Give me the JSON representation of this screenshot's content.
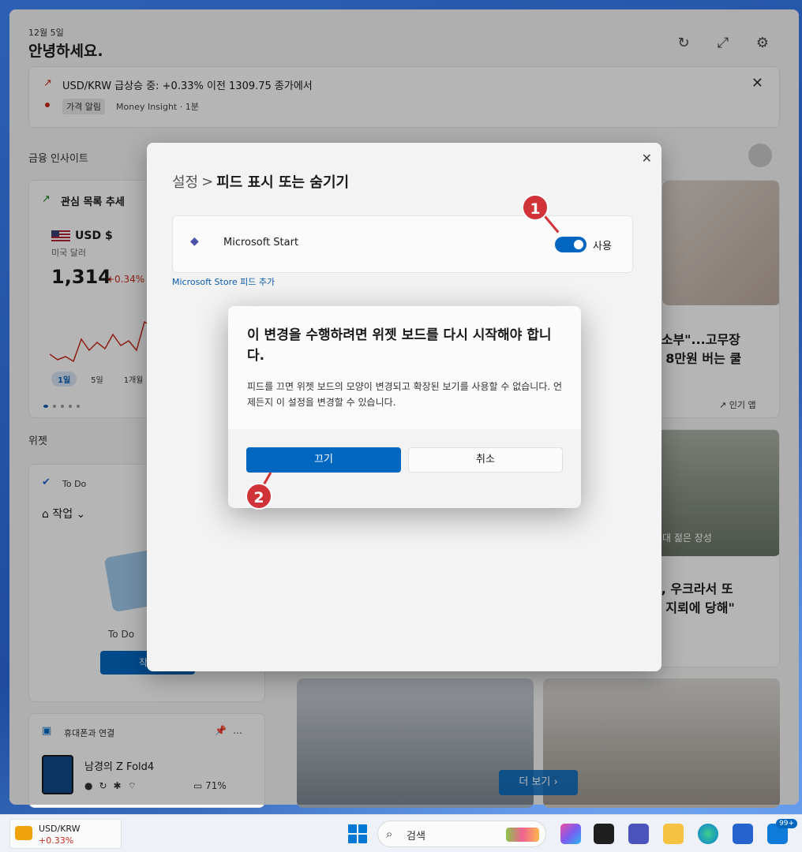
{
  "board": {
    "date": "12월 5일",
    "greeting": "안녕하세요.",
    "icons": [
      "refresh-icon",
      "expand-icon",
      "gear-icon"
    ]
  },
  "alert": {
    "title": "USD/KRW 급상승 중: +0.33% 이전 1309.75 종가에서",
    "tag": "가격 알림",
    "source": "Money Insight · 1분"
  },
  "sections": {
    "finance": "금융 인사이트",
    "widgets": "위젯"
  },
  "watchlist": {
    "title": "관심 목록 추세",
    "symbol": "USD $",
    "symbol_sub": "미국 달러",
    "value": "1,314",
    "change": "+0.34%",
    "ranges": [
      "1일",
      "5일",
      "1개월"
    ]
  },
  "todo": {
    "title": "To Do",
    "list": "작업",
    "empty": "To Do ",
    "button": "작업"
  },
  "phone": {
    "title": "휴대폰과 연결",
    "device": "남경의 Z Fold4",
    "battery": "71%"
  },
  "news": {
    "headline1_line1": "청소부\"...고무장",
    "headline1_line2": "당 8만원 버는 쿨",
    "meta1": "인기 앱",
    "caption2": "대 젊은 장성",
    "headline2_line1": "성, 우크라서 또",
    "headline2_line2": "설 지뢰에 당해\"",
    "more_button": "더 보기"
  },
  "settings": {
    "crumb_root": "설정",
    "crumb_sep": ">",
    "crumb_current": "피드 표시 또는 숨기기",
    "provider_name": "Microsoft Start",
    "toggle_label": "사용",
    "toggle_state": "on",
    "store_link": "Microsoft Store 피드 추가"
  },
  "confirm": {
    "title": "이 변경을 수행하려면 위젯 보드를 다시 시작해야 합니다.",
    "description": "피드를 끄면 위젯 보드의 모양이 변경되고 확장된 보기를 사용할 수 없습니다. 언제든지 이 설정을 변경할 수 있습니다.",
    "primary_button": "끄기",
    "secondary_button": "취소"
  },
  "annotations": {
    "step1": "1",
    "step2": "2",
    "color": "#d13438"
  },
  "taskbar": {
    "widget_name": "USD/KRW",
    "widget_value": "+0.33%",
    "search_text": "검색",
    "notification_count": "99+"
  }
}
